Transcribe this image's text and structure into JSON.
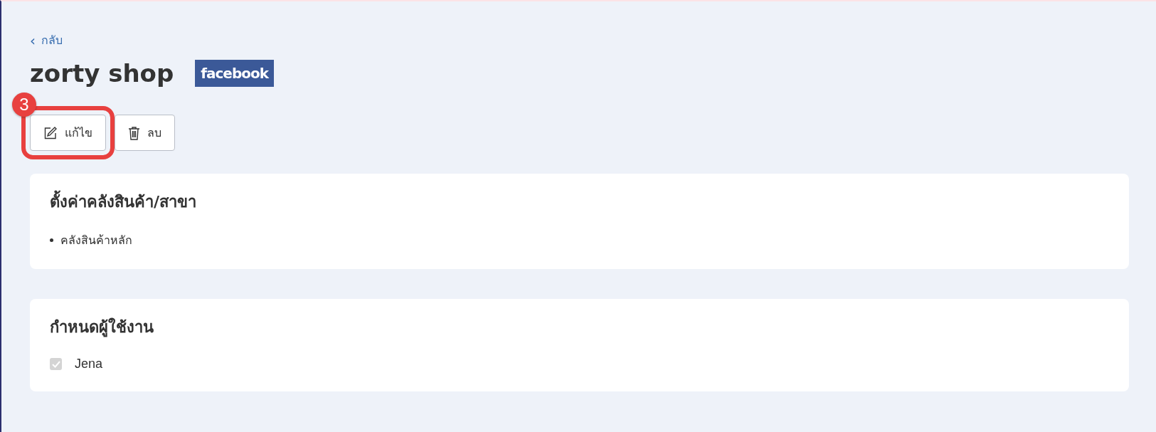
{
  "back_link": {
    "icon": "‹",
    "label": "กลับ"
  },
  "shop": {
    "name": "zorty shop",
    "platform_logo": "facebook"
  },
  "actions": [
    {
      "kind": "edit",
      "label": "แก้ไข",
      "highlighted": true
    },
    {
      "kind": "delete",
      "label": "ลบ",
      "highlighted": false
    }
  ],
  "callout": {
    "number": "3"
  },
  "sections": [
    {
      "kind": "list",
      "title": "ตั้งค่าคลังสินค้า/สาขา",
      "items": [
        {
          "label": "คลังสินค้าหลัก"
        }
      ]
    },
    {
      "kind": "checkboxes",
      "title": "กำหนดผู้ใช้งาน",
      "items": [
        {
          "label": "Jena",
          "checked": true,
          "disabled": true
        }
      ]
    }
  ]
}
